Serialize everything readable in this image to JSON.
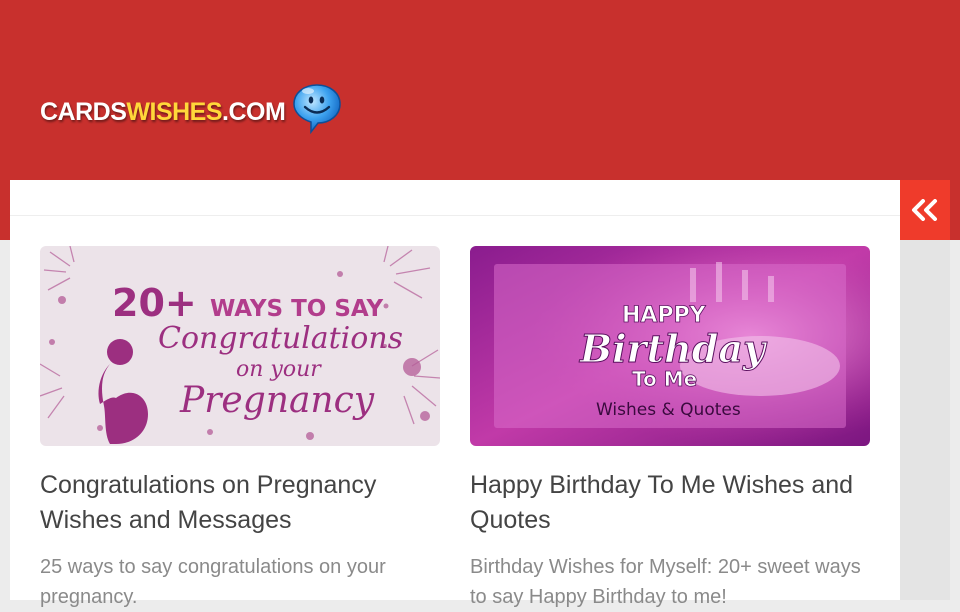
{
  "site": {
    "logo_part1": "CARDS",
    "logo_part2": "WISHES",
    "logo_part3": ".COM"
  },
  "colors": {
    "header_bg": "#c8302d",
    "toggle_bg": "#ef3b2b",
    "logo_accent": "#ffd83a"
  },
  "sidebar_toggle": {
    "icon": "double-chevron-left-icon"
  },
  "posts": [
    {
      "thumbnail": {
        "line1": "20+ WAYS TO SAY",
        "line2": "Congratulations",
        "line3": "on your",
        "line4": "Pregnancy"
      },
      "title": "Congratulations on Pregnancy Wishes and Messages",
      "excerpt": "25 ways to say congratulations on your pregnancy."
    },
    {
      "thumbnail": {
        "line1": "HAPPY",
        "line2": "Birthday",
        "line3": "To Me",
        "line4": "Wishes & Quotes"
      },
      "title": "Happy Birthday To Me Wishes and Quotes",
      "excerpt": "Birthday Wishes for Myself: 20+ sweet ways to say Happy Birthday to me!"
    }
  ]
}
